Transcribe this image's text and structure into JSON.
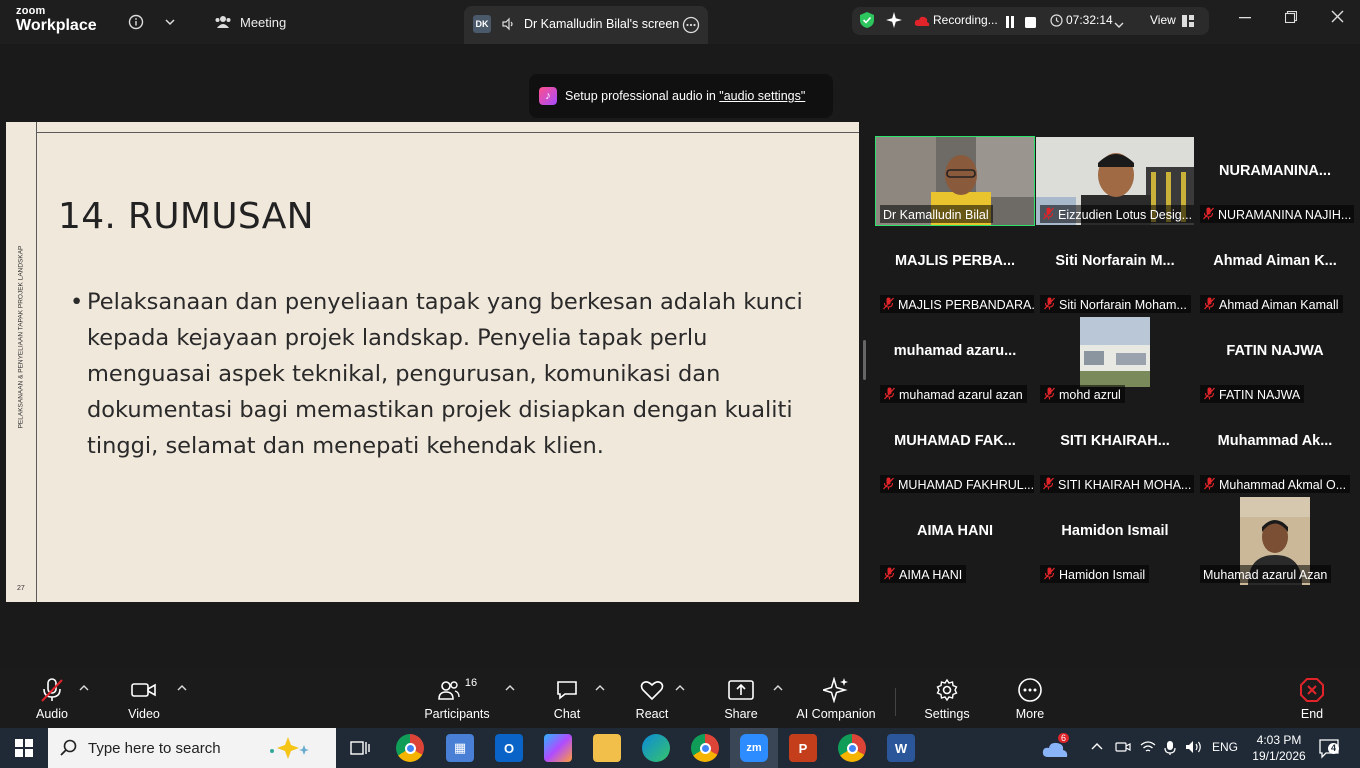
{
  "app": {
    "brand_small": "zoom",
    "brand_big": "Workplace"
  },
  "topbar": {
    "meeting_label": "Meeting",
    "screen_badge": "DK",
    "screen_title": "Dr Kamalludin Bilal's screen",
    "recording_label": "Recording...",
    "timer": "07:32:14",
    "view_label": "View"
  },
  "toast": {
    "text": "Setup professional audio in ",
    "link": "\"audio settings\""
  },
  "slide": {
    "side_text": "PELAKSANAAN & PENYELIAAN TAPAK PROJEK LANDSKAP",
    "page_number": "27",
    "title": "14. RUMUSAN",
    "bullet": "Pelaksanaan dan penyeliaan tapak yang berkesan adalah kunci kepada kejayaan projek landskap. Penyelia tapak perlu menguasai aspek teknikal, pengurusan, komunikasi dan dokumentasi bagi memastikan projek disiapkan dengan kualiti tinggi, selamat dan menepati kehendak klien."
  },
  "participants": [
    {
      "big": "",
      "name": "Dr Kamalludin Bilal",
      "muted": false,
      "video": true
    },
    {
      "big": "",
      "name": "Eizzudien Lotus Desig...",
      "muted": true,
      "video": true
    },
    {
      "big": "NURAMANINA...",
      "name": "NURAMANINA NAJIH...",
      "muted": true,
      "video": false
    },
    {
      "big": "MAJLIS PERBA...",
      "name": "MAJLIS PERBANDARA...",
      "muted": true,
      "video": false
    },
    {
      "big": "Siti  Norfarain  M...",
      "name": "Siti Norfarain Moham...",
      "muted": true,
      "video": false
    },
    {
      "big": "Ahmad Aiman K...",
      "name": "Ahmad Aiman Kamall",
      "muted": true,
      "video": false
    },
    {
      "big": "muhamad  azaru...",
      "name": "muhamad azarul azan",
      "muted": true,
      "video": false
    },
    {
      "big": "",
      "name": "mohd azrul",
      "muted": true,
      "video": true
    },
    {
      "big": "FATIN NAJWA",
      "name": "FATIN NAJWA",
      "muted": true,
      "video": false
    },
    {
      "big": "MUHAMAD  FAK...",
      "name": "MUHAMAD FAKHRUL...",
      "muted": true,
      "video": false
    },
    {
      "big": "SITI  KHAIRAH...",
      "name": "SITI KHAIRAH MOHA...",
      "muted": true,
      "video": false
    },
    {
      "big": "Muhammad  Ak...",
      "name": "Muhammad Akmal O...",
      "muted": true,
      "video": false
    },
    {
      "big": "AIMA HANI",
      "name": "AIMA HANI",
      "muted": true,
      "video": false
    },
    {
      "big": "Hamidon Ismail",
      "name": "Hamidon Ismail",
      "muted": true,
      "video": false
    },
    {
      "big": "",
      "name": "Muhamad azarul Azan",
      "muted": false,
      "video": true
    }
  ],
  "toolbar": {
    "audio": "Audio",
    "video": "Video",
    "participants": "Participants",
    "participants_count": "16",
    "chat": "Chat",
    "react": "React",
    "share": "Share",
    "ai": "AI Companion",
    "settings": "Settings",
    "more": "More",
    "end": "End"
  },
  "taskbar": {
    "search_placeholder": "Type here to search",
    "weather_badge": "6",
    "lang": "ENG",
    "time": "4:03 PM",
    "date": "19/1/2026",
    "notif_count": "4"
  },
  "colors": {
    "accent_green": "#2de36b",
    "muted_red": "#e0242a",
    "end_red": "#e0242a",
    "slide_bg": "#f1e8dc"
  }
}
